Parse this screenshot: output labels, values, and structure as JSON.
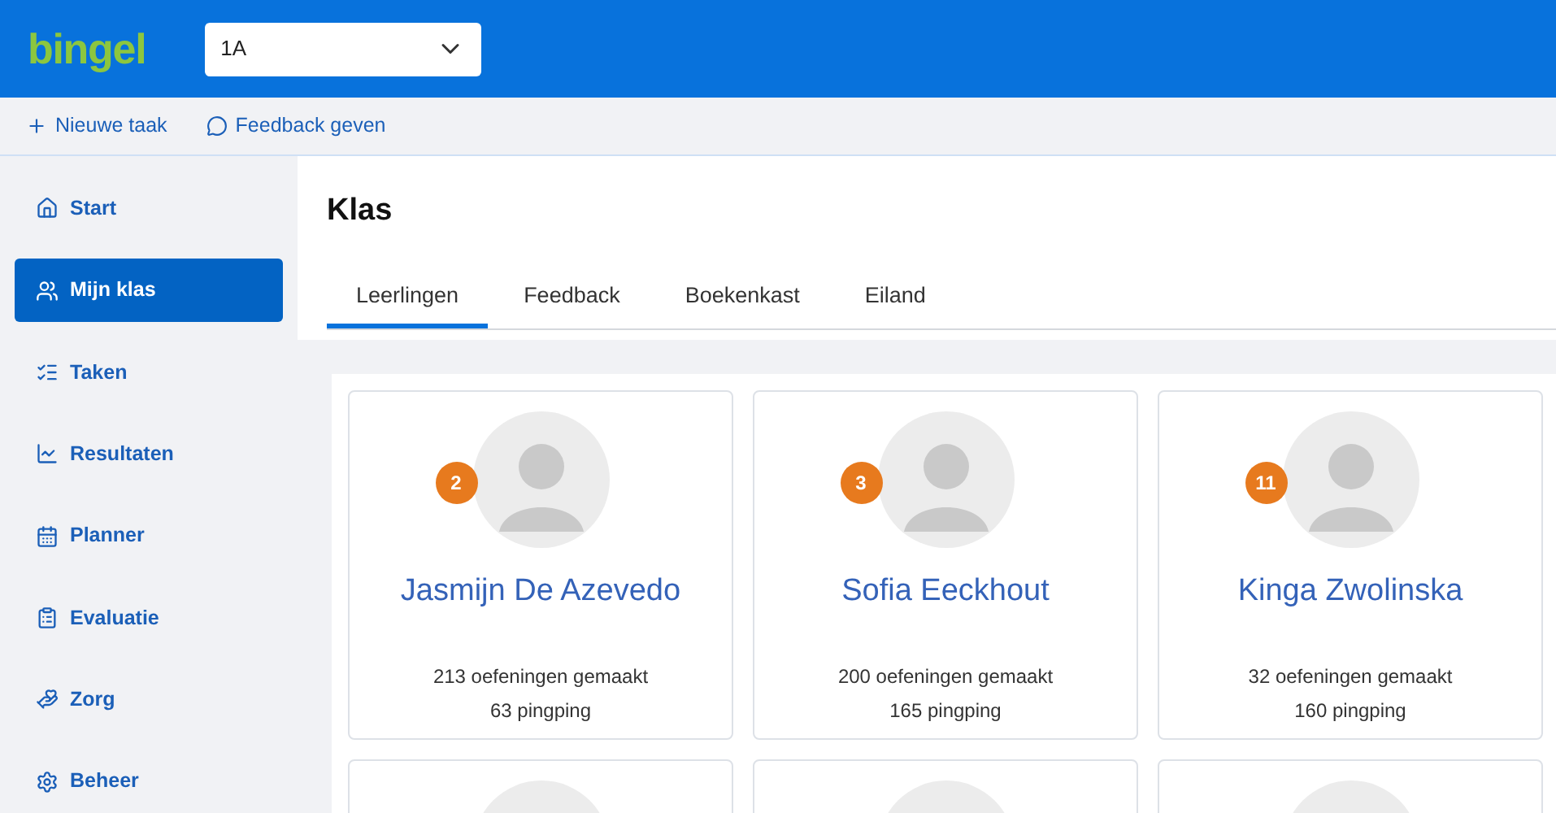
{
  "header": {
    "logo": "bingel",
    "class_select": {
      "value": "1A"
    }
  },
  "toolbar": [
    {
      "label": "Nieuwe taak",
      "kind": "plus"
    },
    {
      "label": "Feedback geven",
      "kind": "comment"
    }
  ],
  "sidebar": {
    "items": [
      {
        "label": "Start",
        "kind": "home",
        "selected": false
      },
      {
        "label": "Mijn klas",
        "kind": "users",
        "selected": true
      },
      {
        "label": "Taken",
        "kind": "tasks",
        "selected": false
      },
      {
        "label": "Resultaten",
        "kind": "chart",
        "selected": false
      },
      {
        "label": "Planner",
        "kind": "calendar",
        "selected": false
      },
      {
        "label": "Evaluatie",
        "kind": "clipboard",
        "selected": false
      },
      {
        "label": "Zorg",
        "kind": "care",
        "selected": false
      },
      {
        "label": "Beheer",
        "kind": "settings",
        "selected": false
      }
    ]
  },
  "page": {
    "title": "Klas",
    "tabs": [
      {
        "label": "Leerlingen",
        "selected": true
      },
      {
        "label": "Feedback",
        "selected": false
      },
      {
        "label": "Boekenkast",
        "selected": false
      },
      {
        "label": "Eiland",
        "selected": false
      }
    ]
  },
  "students": [
    {
      "kind": "full",
      "badge": "2",
      "name": "Jasmijn De Azevedo",
      "exercises": "213 oefeningen gemaakt",
      "pingping": "63 pingping"
    },
    {
      "kind": "full",
      "badge": "3",
      "name": "Sofia Eeckhout",
      "exercises": "200 oefeningen gemaakt",
      "pingping": "165 pingping"
    },
    {
      "kind": "full",
      "badge": "11",
      "name": "Kinga Zwolinska",
      "exercises": "32 oefeningen gemaakt",
      "pingping": "160 pingping"
    },
    {
      "kind": "cut_off"
    },
    {
      "kind": "cut_off"
    },
    {
      "kind": "cut_off"
    }
  ]
}
